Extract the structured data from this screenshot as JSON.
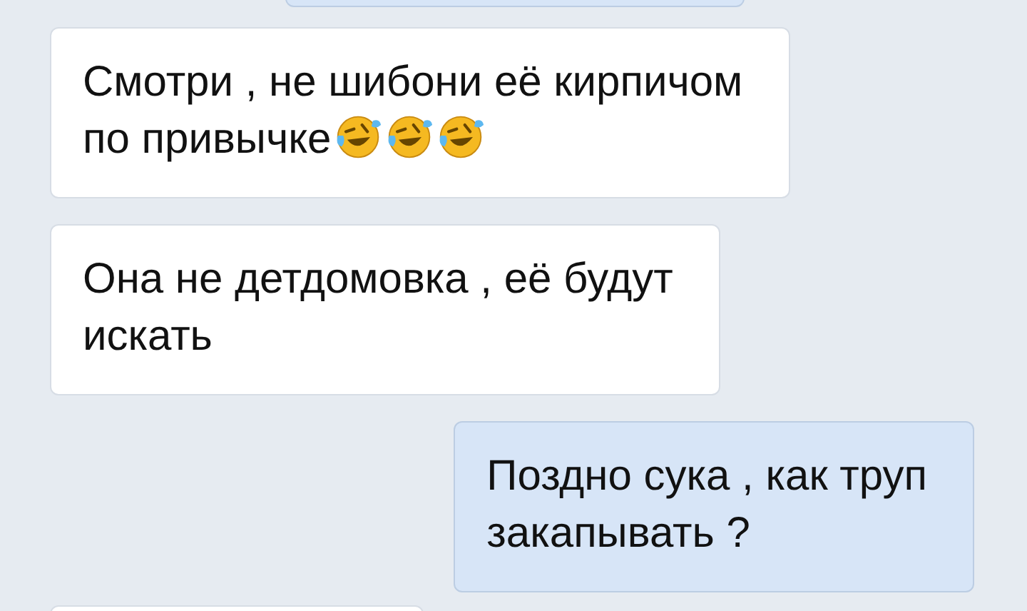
{
  "messages": [
    {
      "outgoing": false,
      "lines": [
        "Смотри , не шибони её кирпичом",
        "по привычке"
      ],
      "emoji": [
        {
          "kind": "laughing"
        },
        {
          "kind": "laughing"
        },
        {
          "kind": "laughing"
        }
      ]
    },
    {
      "outgoing": false,
      "lines": [
        "Она не детдомовка , её будут",
        "искать"
      ]
    },
    {
      "outgoing": true,
      "lines": [
        "Поздно сука , как труп",
        "закапывать ?"
      ]
    }
  ]
}
